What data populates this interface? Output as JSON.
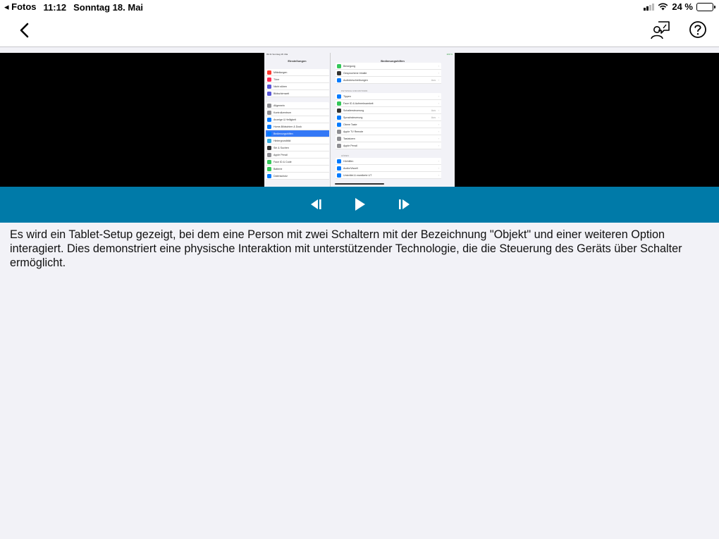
{
  "status_bar": {
    "back_app": "◂ Fotos",
    "time": "11:12",
    "date": "Sonntag 18. Mai",
    "battery": "24 %",
    "battery_level": 0.24
  },
  "nav": {
    "back_icon": "chevron-left-icon",
    "feedback_icon": "person-speech-bubble-icon",
    "help_icon": "question-circle-icon"
  },
  "video": {
    "screenshot": {
      "status_time": "09:41",
      "status_date": "Sonntag 18. Mai",
      "status_battery": "100 %",
      "left_title": "Einstellungen",
      "right_title": "Bedienungshilfen",
      "left_group1": [
        {
          "label": "Mitteilungen",
          "color": "#ff3b30"
        },
        {
          "label": "Töne",
          "color": "#ff2d55"
        },
        {
          "label": "Nicht stören",
          "color": "#5856d6"
        },
        {
          "label": "Bildschirmzeit",
          "color": "#5856d6"
        }
      ],
      "left_group2": [
        {
          "label": "Allgemein",
          "color": "#8e8e93"
        },
        {
          "label": "Kontrollzentrum",
          "color": "#8e8e93"
        },
        {
          "label": "Anzeige & Helligkeit",
          "color": "#007aff"
        },
        {
          "label": "Home-Bildschirm & Dock",
          "color": "#007aff"
        },
        {
          "label": "Bedienungshilfen",
          "color": "#007aff"
        },
        {
          "label": "Hintergrundbild",
          "color": "#34aadc"
        },
        {
          "label": "Siri & Suchen",
          "color": "#333"
        },
        {
          "label": "Apple Pencil",
          "color": "#8e8e93"
        },
        {
          "label": "Face ID & Code",
          "color": "#34c759"
        },
        {
          "label": "Batterie",
          "color": "#34c759"
        },
        {
          "label": "Datenschutz",
          "color": "#007aff"
        }
      ],
      "right_group1": [
        {
          "label": "Bewegung",
          "color": "#34c759",
          "value": ""
        },
        {
          "label": "Gesprochene Inhalte",
          "color": "#333",
          "value": ""
        },
        {
          "label": "Audiobeschreibungen",
          "color": "#007aff",
          "value": "Aus"
        }
      ],
      "right_section2": "PHYSISCH UND MOTORIK",
      "right_group2": [
        {
          "label": "Tippen",
          "color": "#007aff",
          "value": ""
        },
        {
          "label": "Face ID & Aufmerksamkeit",
          "color": "#34c759",
          "value": ""
        },
        {
          "label": "Schaltersteuerung",
          "color": "#333",
          "value": "Aus"
        },
        {
          "label": "Sprachsteuerung",
          "color": "#007aff",
          "value": "Aus"
        },
        {
          "label": "Obere Taste",
          "color": "#007aff",
          "value": ""
        },
        {
          "label": "Apple TV Remote",
          "color": "#8e8e93",
          "value": ""
        },
        {
          "label": "Tastaturen",
          "color": "#8e8e93",
          "value": ""
        },
        {
          "label": "Apple Pencil",
          "color": "#8e8e93",
          "value": ""
        }
      ],
      "right_section3": "HÖREN",
      "right_group3": [
        {
          "label": "Hörhilfen",
          "color": "#007aff",
          "value": ""
        },
        {
          "label": "Audio/Visuell",
          "color": "#007aff",
          "value": ""
        },
        {
          "label": "Untertitel & erweiterte UT",
          "color": "#007aff",
          "value": ""
        }
      ]
    }
  },
  "controls": {
    "prev_icon": "step-backward-icon",
    "play_icon": "play-icon",
    "next_icon": "step-forward-icon",
    "bar_color": "#007aa8"
  },
  "description": "Es wird ein Tablet-Setup gezeigt, bei dem eine Person mit zwei Schaltern mit der Bezeichnung \"Objekt\" und einer weiteren Option interagiert. Dies demonstriert eine physische Interaktion mit unterstützender Technologie, die die Steuerung des Geräts über Schalter ermöglicht."
}
